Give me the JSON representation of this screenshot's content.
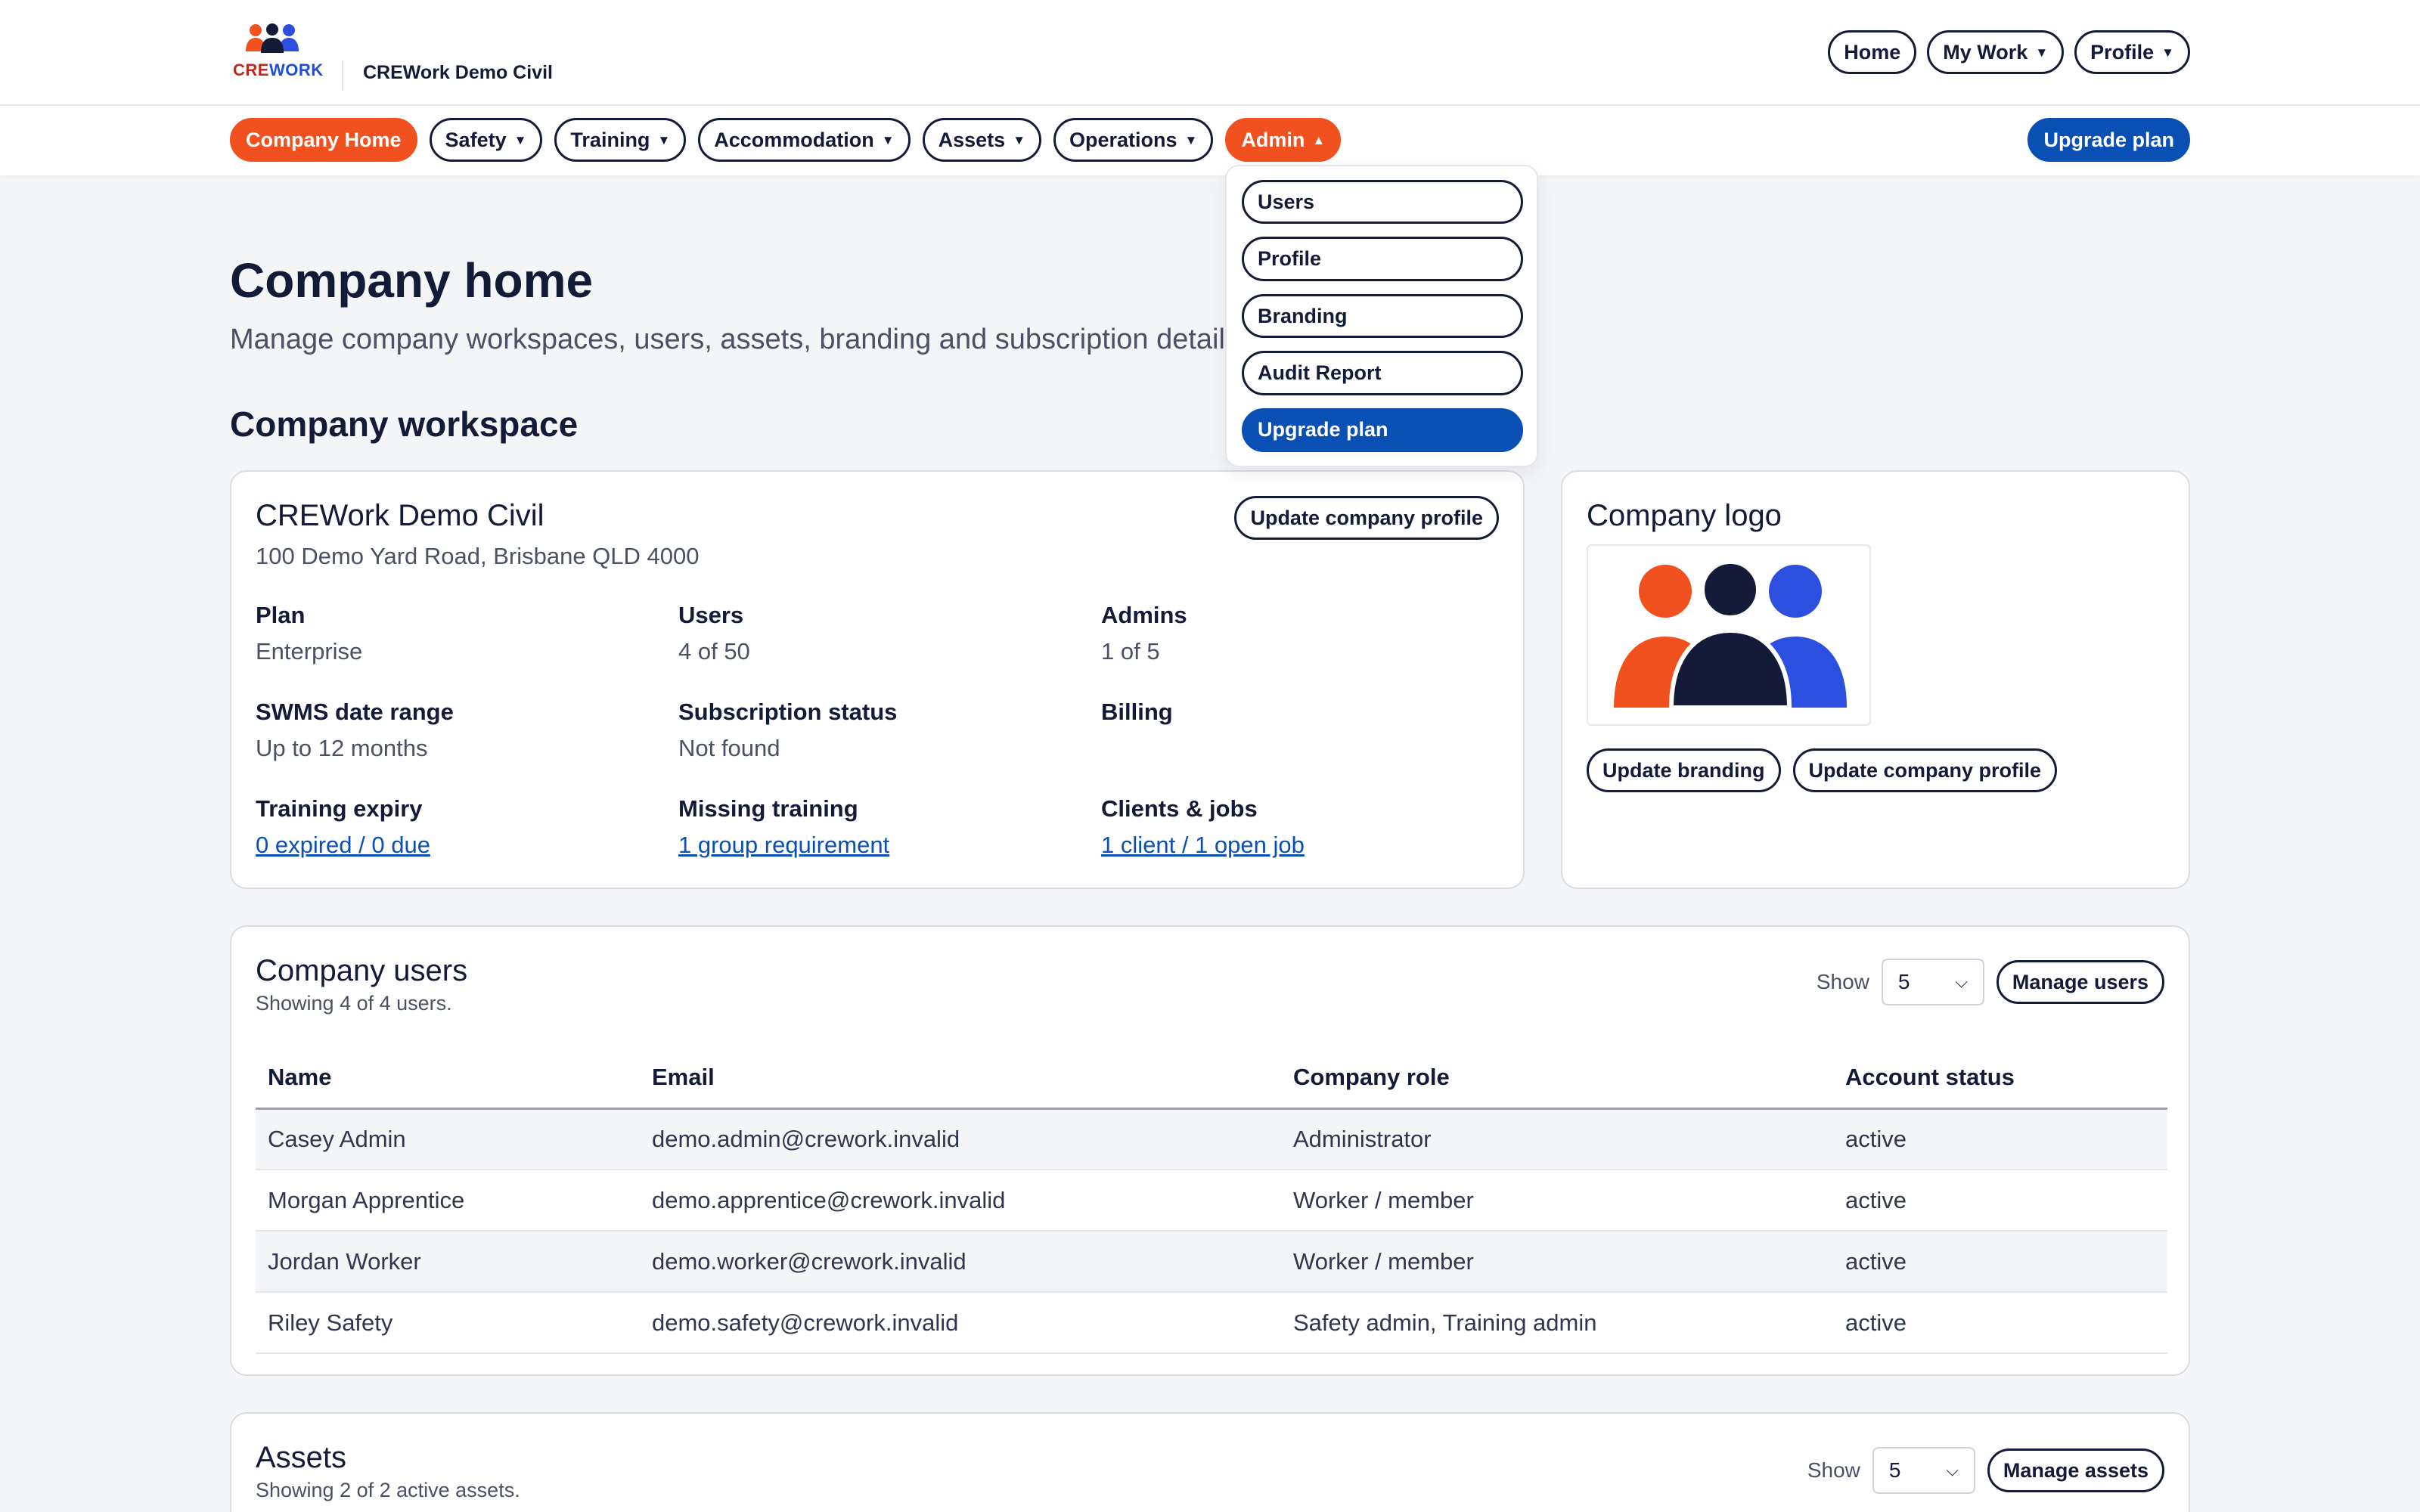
{
  "brand": {
    "word_cre": "CRE",
    "word_work": "WORK",
    "company": "CREWork Demo Civil"
  },
  "top_nav": {
    "home": "Home",
    "my_work": "My Work",
    "profile": "Profile"
  },
  "nav": {
    "company_home": "Company Home",
    "safety": "Safety",
    "training": "Training",
    "accommodation": "Accommodation",
    "assets": "Assets",
    "operations": "Operations",
    "admin": "Admin",
    "upgrade_plan": "Upgrade plan"
  },
  "admin_menu": {
    "users": "Users",
    "profile": "Profile",
    "branding": "Branding",
    "audit_report": "Audit Report",
    "upgrade_plan": "Upgrade plan"
  },
  "page": {
    "title": "Company home",
    "subtitle": "Manage company workspaces, users, assets, branding and subscription details.",
    "section": "Company workspace"
  },
  "workspace": {
    "name": "CREWork Demo Civil",
    "address": "100 Demo Yard Road, Brisbane QLD 4000",
    "update_button": "Update company profile",
    "stats": {
      "plan": {
        "label": "Plan",
        "value": "Enterprise"
      },
      "users": {
        "label": "Users",
        "value": "4 of 50"
      },
      "admins": {
        "label": "Admins",
        "value": "1 of 5"
      },
      "swms": {
        "label": "SWMS date range",
        "value": "Up to 12 months"
      },
      "subscription": {
        "label": "Subscription status",
        "value": "Not found"
      },
      "billing": {
        "label": "Billing",
        "value": ""
      },
      "training_expiry": {
        "label": "Training expiry",
        "value": "0 expired / 0 due"
      },
      "missing_training": {
        "label": "Missing training",
        "value": "1 group requirement"
      },
      "clients_jobs": {
        "label": "Clients & jobs",
        "value": "1 client / 1 open job"
      }
    }
  },
  "logo_card": {
    "title": "Company logo",
    "update_branding": "Update branding",
    "update_profile": "Update company profile"
  },
  "users_card": {
    "title": "Company users",
    "subtitle": "Showing 4 of 4 users.",
    "show_label": "Show",
    "show_value": "5",
    "manage_button": "Manage users",
    "columns": [
      "Name",
      "Email",
      "Company role",
      "Account status"
    ],
    "rows": [
      [
        "Casey Admin",
        "demo.admin@crework.invalid",
        "Administrator",
        "active"
      ],
      [
        "Morgan Apprentice",
        "demo.apprentice@crework.invalid",
        "Worker / member",
        "active"
      ],
      [
        "Jordan Worker",
        "demo.worker@crework.invalid",
        "Worker / member",
        "active"
      ],
      [
        "Riley Safety",
        "demo.safety@crework.invalid",
        "Safety admin, Training admin",
        "active"
      ]
    ]
  },
  "assets_card": {
    "title": "Assets",
    "subtitle": "Showing 2 of 2 active assets.",
    "show_label": "Show",
    "show_value": "5",
    "manage_button": "Manage assets"
  },
  "icons": {
    "caret": "caret-down-icon",
    "caret_up": "caret-up-icon",
    "chevron": "chevron-down-icon"
  },
  "colors": {
    "accent_orange": "#f0511f",
    "accent_blue": "#0a4fb4",
    "navy": "#141b38",
    "link": "#0a4fb4"
  }
}
